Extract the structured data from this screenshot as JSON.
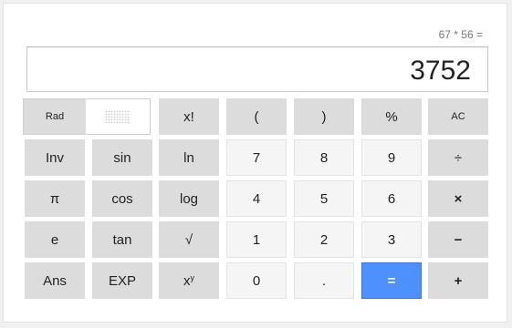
{
  "calculator": {
    "expression": "67 * 56 =",
    "display_value": "3752",
    "mode": {
      "rad_label": "Rad"
    },
    "keys": {
      "factorial": "x!",
      "open_paren": "(",
      "close_paren": ")",
      "percent": "%",
      "all_clear": "AC",
      "inv": "Inv",
      "sin": "sin",
      "ln": "ln",
      "seven": "7",
      "eight": "8",
      "nine": "9",
      "divide": "÷",
      "pi": "π",
      "cos": "cos",
      "log": "log",
      "four": "4",
      "five": "5",
      "six": "6",
      "multiply": "×",
      "e": "e",
      "tan": "tan",
      "sqrt": "√",
      "one": "1",
      "two": "2",
      "three": "3",
      "minus": "−",
      "ans": "Ans",
      "exp": "EXP",
      "power_base": "x",
      "power_exp": "y",
      "zero": "0",
      "dot": ".",
      "equals": "=",
      "plus": "+"
    },
    "colors": {
      "accent": "#4d90fe"
    }
  }
}
